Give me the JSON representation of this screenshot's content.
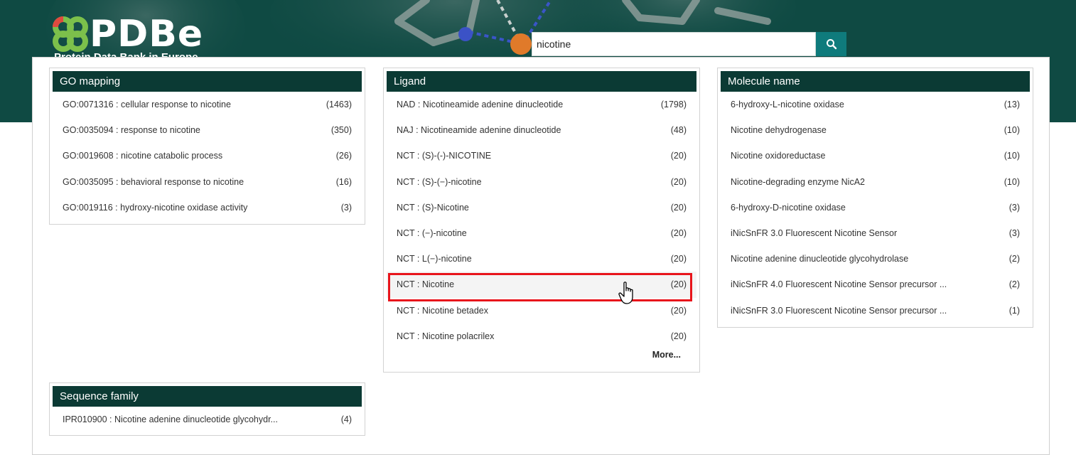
{
  "header": {
    "logo_text": "PDBe",
    "logo_subtitle": "Protein Data Bank in Europe",
    "colors": {
      "banner": "#0f4a43",
      "logo_green": "#7cc04b",
      "logo_red": "#e04a3f"
    }
  },
  "search": {
    "value": "nicotine",
    "button_icon": "search-icon"
  },
  "go_mapping": {
    "title": "GO mapping",
    "items": [
      {
        "label": "GO:0071316 : cellular response to nicotine",
        "count": "(1463)"
      },
      {
        "label": "GO:0035094 : response to nicotine",
        "count": "(350)"
      },
      {
        "label": "GO:0019608 : nicotine catabolic process",
        "count": "(26)"
      },
      {
        "label": "GO:0035095 : behavioral response to nicotine",
        "count": "(16)"
      },
      {
        "label": "GO:0019116 : hydroxy-nicotine oxidase activity",
        "count": "(3)"
      }
    ]
  },
  "ligand": {
    "title": "Ligand",
    "items": [
      {
        "label": "NAD : Nicotineamide adenine dinucleotide",
        "count": "(1798)"
      },
      {
        "label": "NAJ : Nicotineamide adenine dinucleotide",
        "count": "(48)"
      },
      {
        "label": "NCT : (S)-(-)-NICOTINE",
        "count": "(20)"
      },
      {
        "label": "NCT : (S)-(−)-nicotine",
        "count": "(20)"
      },
      {
        "label": "NCT : (S)-Nicotine",
        "count": "(20)"
      },
      {
        "label": "NCT : (−)-nicotine",
        "count": "(20)"
      },
      {
        "label": "NCT : L(−)-nicotine",
        "count": "(20)"
      },
      {
        "label": "NCT : Nicotine",
        "count": "(20)"
      },
      {
        "label": "NCT : Nicotine betadex",
        "count": "(20)"
      },
      {
        "label": "NCT : Nicotine polacrilex",
        "count": "(20)"
      }
    ],
    "more_label": "More..."
  },
  "molecule_name": {
    "title": "Molecule name",
    "items": [
      {
        "label": "6-hydroxy-L-nicotine oxidase",
        "count": "(13)"
      },
      {
        "label": "Nicotine dehydrogenase",
        "count": "(10)"
      },
      {
        "label": "Nicotine oxidoreductase",
        "count": "(10)"
      },
      {
        "label": "Nicotine-degrading enzyme NicA2",
        "count": "(10)"
      },
      {
        "label": "6-hydroxy-D-nicotine oxidase",
        "count": "(3)"
      },
      {
        "label": "iNicSnFR 3.0 Fluorescent Nicotine Sensor",
        "count": "(3)"
      },
      {
        "label": "Nicotine adenine dinucleotide glycohydrolase",
        "count": "(2)"
      },
      {
        "label": "iNicSnFR 4.0 Fluorescent Nicotine Sensor precursor ...",
        "count": "(2)"
      },
      {
        "label": "iNicSnFR 3.0 Fluorescent Nicotine Sensor precursor ...",
        "count": "(1)"
      }
    ]
  },
  "sequence_family": {
    "title": "Sequence family",
    "items": [
      {
        "label": "IPR010900 : Nicotine adenine dinucleotide glycohydr...",
        "count": "(4)"
      }
    ]
  },
  "highlight_color": "#e8141b"
}
